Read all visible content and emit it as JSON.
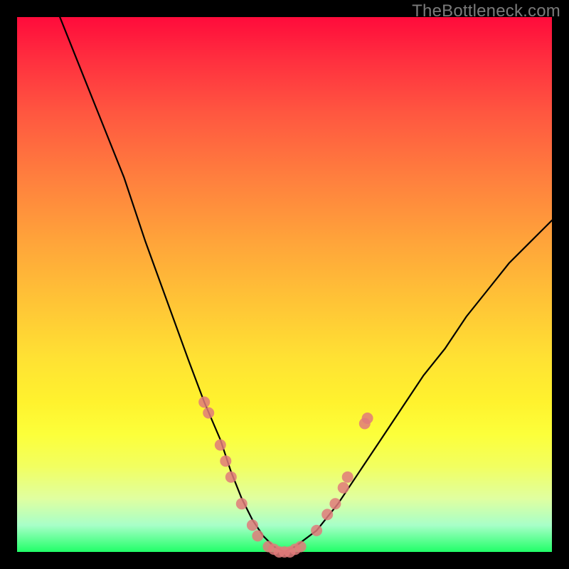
{
  "watermark": "TheBottleneck.com",
  "chart_data": {
    "type": "line",
    "title": "",
    "xlabel": "",
    "ylabel": "",
    "xlim": [
      0,
      100
    ],
    "ylim": [
      0,
      100
    ],
    "grid": false,
    "legend": false,
    "series": [
      {
        "name": "bottleneck-curve",
        "x": [
          8,
          12,
          16,
          20,
          24,
          28,
          32,
          35,
          38,
          40,
          42,
          44,
          46,
          48,
          50,
          52,
          56,
          60,
          64,
          68,
          72,
          76,
          80,
          84,
          88,
          92,
          96,
          100
        ],
        "y": [
          100,
          90,
          80,
          70,
          58,
          47,
          36,
          28,
          21,
          15,
          10,
          6,
          3,
          1,
          0,
          1,
          4,
          9,
          15,
          21,
          27,
          33,
          38,
          44,
          49,
          54,
          58,
          62
        ]
      }
    ],
    "markers": {
      "name": "highlight-dots",
      "color": "#e07a7a",
      "points": [
        {
          "x": 35.0,
          "y": 28
        },
        {
          "x": 35.8,
          "y": 26
        },
        {
          "x": 38.0,
          "y": 20
        },
        {
          "x": 39.0,
          "y": 17
        },
        {
          "x": 40.0,
          "y": 14
        },
        {
          "x": 42.0,
          "y": 9
        },
        {
          "x": 44.0,
          "y": 5
        },
        {
          "x": 45.0,
          "y": 3
        },
        {
          "x": 47.0,
          "y": 1
        },
        {
          "x": 48.0,
          "y": 0.5
        },
        {
          "x": 49.0,
          "y": 0
        },
        {
          "x": 50.0,
          "y": 0
        },
        {
          "x": 51.0,
          "y": 0
        },
        {
          "x": 52.0,
          "y": 0.5
        },
        {
          "x": 53.0,
          "y": 1
        },
        {
          "x": 56.0,
          "y": 4
        },
        {
          "x": 58.0,
          "y": 7
        },
        {
          "x": 59.5,
          "y": 9
        },
        {
          "x": 61.0,
          "y": 12
        },
        {
          "x": 61.8,
          "y": 14
        },
        {
          "x": 65.0,
          "y": 24
        },
        {
          "x": 65.5,
          "y": 25
        }
      ]
    },
    "background_gradient": {
      "top": "#ff0b3b",
      "mid": "#ffe233",
      "bottom": "#21ff68"
    }
  }
}
